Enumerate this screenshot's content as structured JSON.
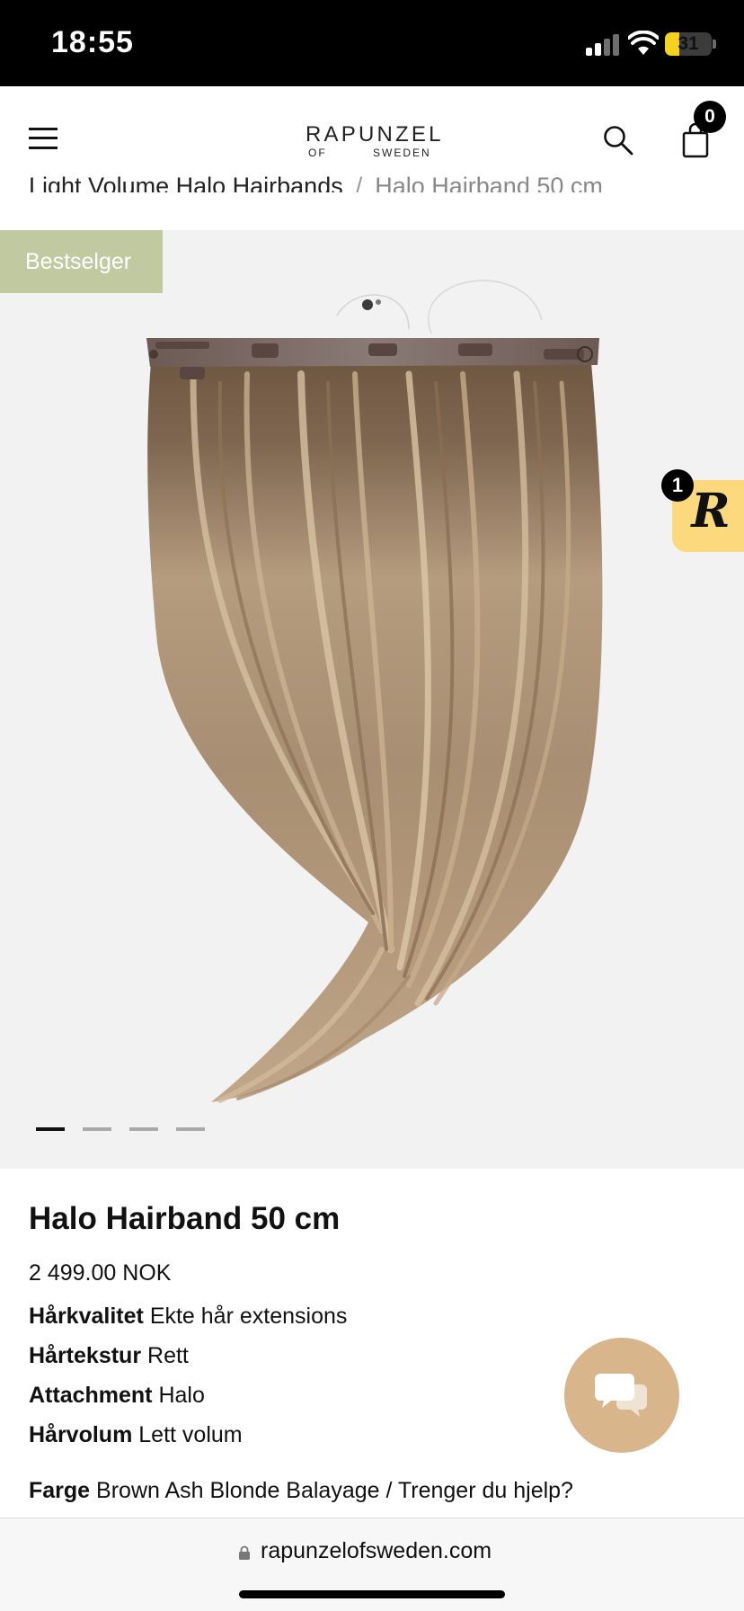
{
  "status_bar": {
    "time": "18:55",
    "battery": "31",
    "battery_level": 0.31,
    "icons": [
      "signal-icon",
      "wifi-icon",
      "battery-icon"
    ]
  },
  "header": {
    "logo_main": "RAPUNZEL",
    "logo_sub_left": "OF",
    "logo_sub_right": "SWEDEN",
    "cart_count": "0",
    "icons": [
      "menu-icon",
      "search-icon",
      "cart-icon"
    ]
  },
  "breadcrumb": {
    "parent": "Light Volume Halo Hairbands",
    "separator": "/",
    "current": "Halo Hairband 50 cm"
  },
  "gallery": {
    "badge": "Bestselger",
    "badge_color": "#c0c9a0",
    "image_count": 4,
    "active_index": 0
  },
  "loyalty": {
    "letter": "R",
    "count": "1",
    "color": "#fcd97c"
  },
  "product": {
    "title": "Halo Hairband 50 cm",
    "price": "2 499.00 NOK",
    "attributes": [
      {
        "label": "Hårkvalitet",
        "value": "Ekte hår extensions"
      },
      {
        "label": "Hårtekstur",
        "value": "Rett"
      },
      {
        "label": "Attachment",
        "value": "Halo"
      },
      {
        "label": "Hårvolum",
        "value": "Lett volum"
      },
      {
        "label": "Farge",
        "value": "Brown Ash Blonde Balayage / Trenger du hjelp?"
      }
    ]
  },
  "chat": {
    "icon": "chat-bubbles-icon",
    "color": "#d8b58b"
  },
  "browser": {
    "url": "rapunzelofsweden.com",
    "icon": "lock-icon"
  }
}
